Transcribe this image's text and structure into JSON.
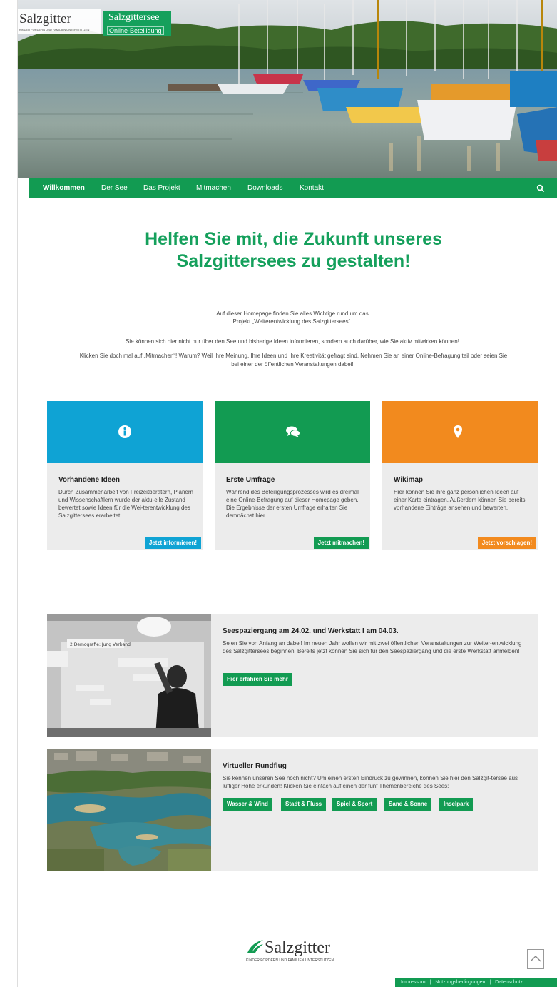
{
  "brand": {
    "city_logo": "Salzgitter",
    "city_tagline": "KINDER FÖRDERN UND FAMILIEN UNTERSTÜTZEN",
    "site_title": "Salzgittersee",
    "site_subtitle": "Online-Beteiligung"
  },
  "nav": {
    "items": [
      {
        "label": "Willkommen"
      },
      {
        "label": "Der See"
      },
      {
        "label": "Das Projekt"
      },
      {
        "label": "Mitmachen"
      },
      {
        "label": "Downloads"
      },
      {
        "label": "Kontakt"
      }
    ],
    "search_icon": "search-icon"
  },
  "main": {
    "headline_line1": "Helfen Sie mit, die Zukunft unseres",
    "headline_line2": "Salzgittersees zu gestalten!",
    "intro": [
      "Auf dieser Homepage finden Sie alles Wichtige rund um das",
      "Projekt „Weiterentwicklung des Salzgittersees“.",
      "Sie können sich hier nicht nur über den See und bisherige Ideen informieren, sondern auch darüber, wie Sie aktiv mitwirken können!",
      "Klicken Sie doch mal auf „Mitmachen“! Warum? Weil Ihre Meinung, Ihre Ideen und Ihre Kreativität gefragt sind. Nehmen Sie an einer Online-Befragung teil oder seien Sie",
      "bei einer der öffentlichen Veranstaltungen dabei!"
    ]
  },
  "cards": [
    {
      "icon": "info-icon",
      "color": "#0fa3d4",
      "title": "Vorhandene Ideen",
      "text": "Durch Zusammenarbeit von Freizeitberatern, Planern und Wissenschaftlern wurde der aktu-elle Zustand bewertet sowie Ideen für die Wei-terentwicklung des Salzgittersees erarbeitet.",
      "cta": "Jetzt informieren!"
    },
    {
      "icon": "chat-bubbles-icon",
      "color": "#129b52",
      "title": "Erste Umfrage",
      "text": "Während des Beteiligungsprozesses wird es dreimal eine Online-Befragung auf dieser Homepage geben. Die Ergebnisse der ersten Umfrage erhalten Sie demnächst hier.",
      "cta": "Jetzt mitmachen!"
    },
    {
      "icon": "map-pin-icon",
      "color": "#f28a1e",
      "title": "Wikimap",
      "text": "Hier können Sie ihre ganz persönlichen Ideen auf einer Karte eintragen. Außerdem können Sie bereits vorhandene Einträge ansehen und bewerten.",
      "cta": "Jetzt vorschlagen!"
    }
  ],
  "features": [
    {
      "title": "Seespaziergang am 24.02. und Werkstatt I am 04.03.",
      "text": "Seien Sie von Anfang an dabei! Im neuen Jahr wollen wir mit zwei öffentlichen Veranstaltungen zur Weiter-entwicklung des Salzgittersees beginnen. Bereits jetzt können Sie sich für den Seespaziergang und die erste Werkstatt anmelden!",
      "button": "Hier erfahren Sie mehr",
      "whiteboard_text": "2 Demografie: Jung Verbandl"
    },
    {
      "title": "Virtueller Rundflug",
      "text": "Sie kennen unseren See noch nicht? Um einen ersten Eindruck zu gewinnen, können Sie hier den Salzgit-tersee aus luftiger Höhe erkunden! Klicken Sie einfach auf einen der fünf Themenbereiche des Sees:",
      "buttons": [
        "Wasser & Wind",
        "Stadt & Fluss",
        "Spiel & Sport",
        "Sand & Sonne",
        "Inselpark"
      ]
    }
  ],
  "footer": {
    "logo": "Salzgitter",
    "tagline": "KINDER FÖRDERN UND FAMILIEN UNTERSTÜTZEN",
    "links": [
      "Impressum",
      "|",
      "Nutzungsbedingungen",
      "|",
      "Datenschutz"
    ]
  },
  "colors": {
    "brand_green": "#129b52",
    "headline_green": "#15a05c",
    "blue": "#0fa3d4",
    "orange": "#f28a1e"
  }
}
